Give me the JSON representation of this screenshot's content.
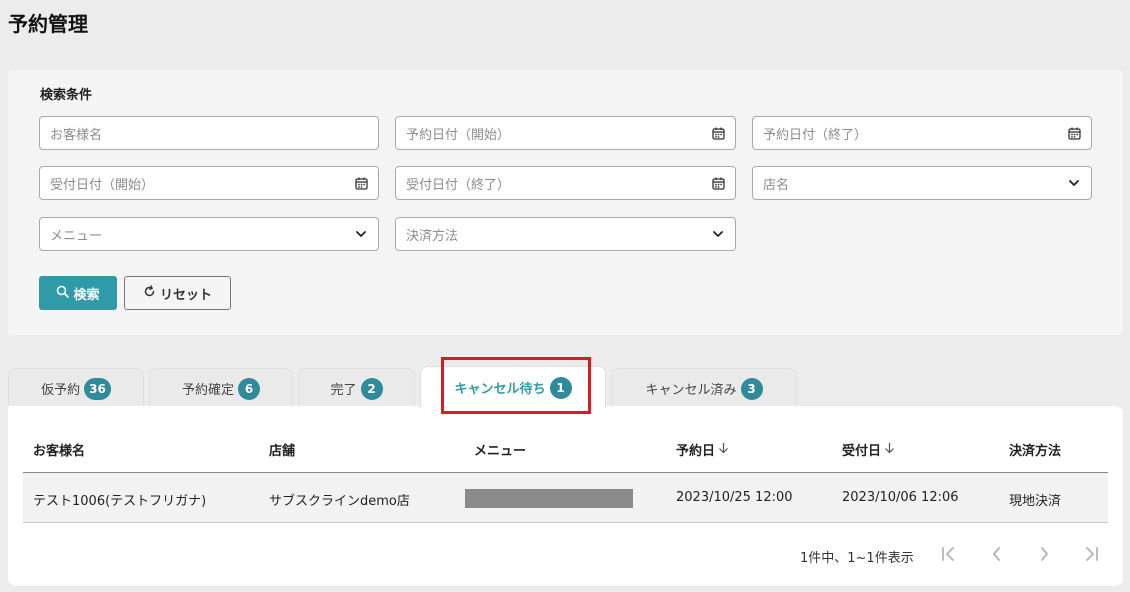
{
  "page": {
    "title": "予約管理"
  },
  "search": {
    "heading": "検索条件",
    "fields": {
      "customer_name": {
        "placeholder": "お客様名"
      },
      "reservation_date_start": {
        "placeholder": "予約日付（開始）"
      },
      "reservation_date_end": {
        "placeholder": "予約日付（終了）"
      },
      "received_date_start": {
        "placeholder": "受付日付（開始）"
      },
      "received_date_end": {
        "placeholder": "受付日付（終了）"
      },
      "store": {
        "placeholder": "店名"
      },
      "menu": {
        "placeholder": "メニュー"
      },
      "payment": {
        "placeholder": "決済方法"
      }
    },
    "search_button": "検索",
    "reset_button": "リセット"
  },
  "tabs": [
    {
      "label": "仮予約",
      "count": "36",
      "active": false
    },
    {
      "label": "予約確定",
      "count": "6",
      "active": false
    },
    {
      "label": "完了",
      "count": "2",
      "active": false
    },
    {
      "label": "キャンセル待ち",
      "count": "1",
      "active": true
    },
    {
      "label": "キャンセル済み",
      "count": "3",
      "active": false
    }
  ],
  "table": {
    "headers": {
      "customer": "お客様名",
      "store": "店舗",
      "menu": "メニュー",
      "reservation_date": "予約日",
      "received_date": "受付日",
      "payment": "決済方法"
    },
    "rows": [
      {
        "customer": "テスト1006(テストフリガナ)",
        "store": "サブスクラインdemo店",
        "menu": "",
        "reservation_date": "2023/10/25 12:00",
        "received_date": "2023/10/06 12:06",
        "payment": "現地決済"
      }
    ]
  },
  "pagination": {
    "summary": "1件中、1~1件表示"
  },
  "colors": {
    "accent": "#2f9aa8",
    "badge": "#2f8a99",
    "highlight": "#e0191c"
  },
  "icons": [
    "calendar-icon",
    "chevron-down-icon",
    "search-icon",
    "refresh-icon",
    "sort-down-icon",
    "first-page-icon",
    "prev-page-icon",
    "next-page-icon",
    "last-page-icon"
  ]
}
